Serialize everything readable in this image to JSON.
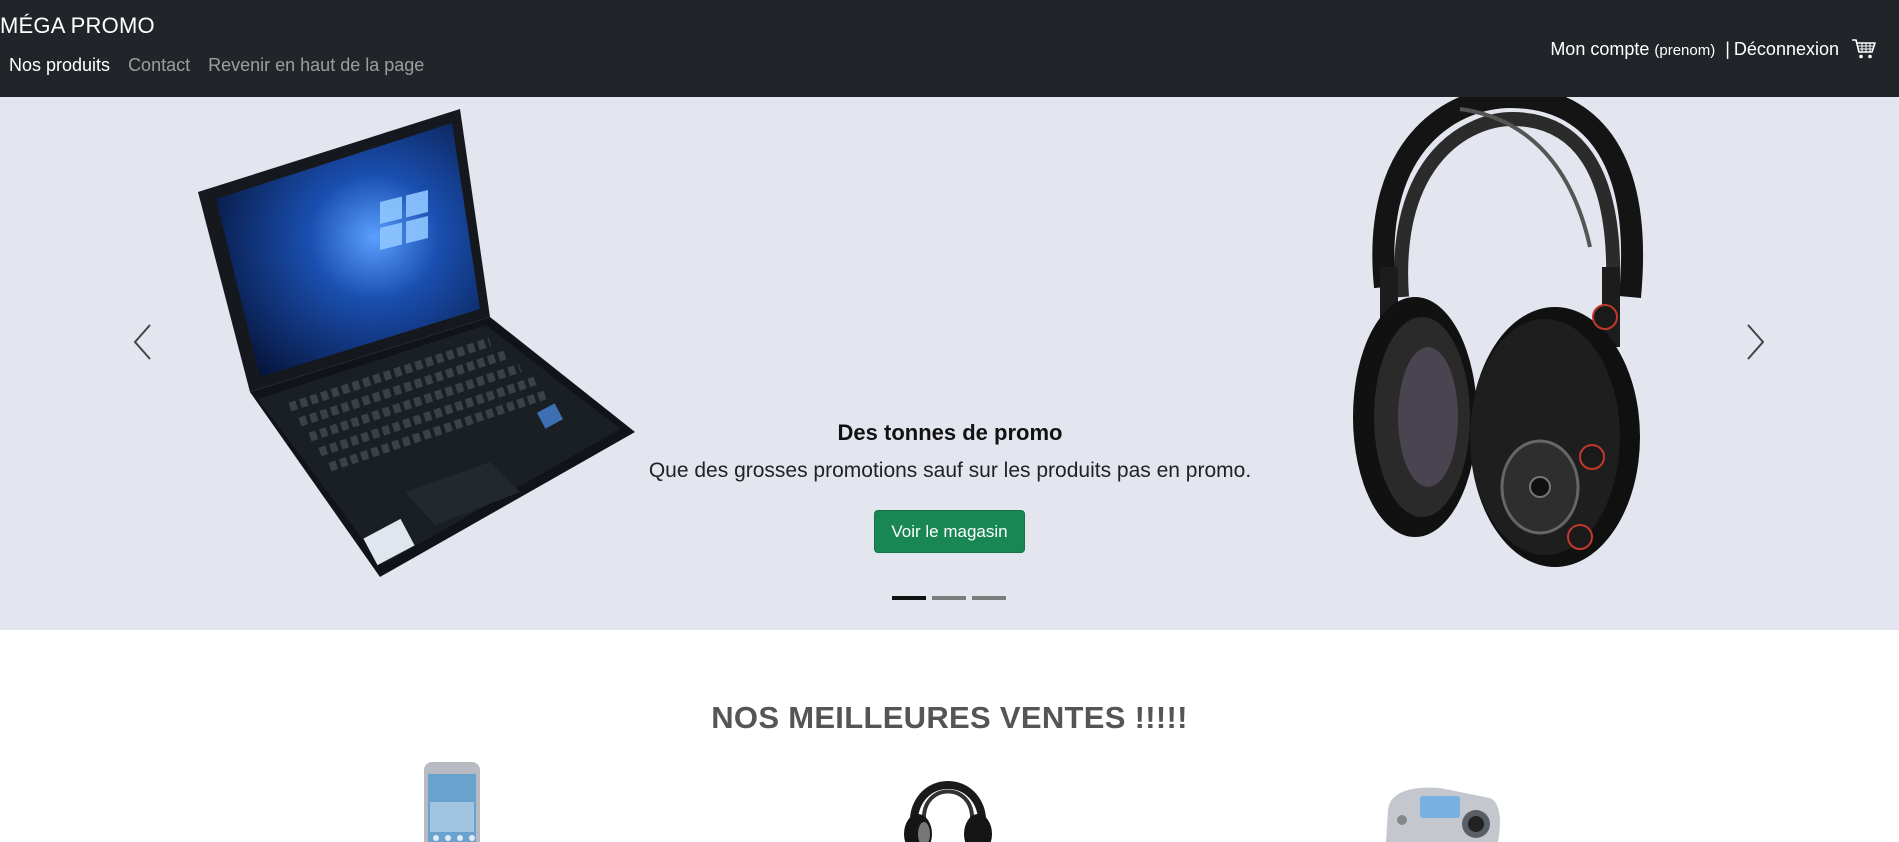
{
  "navbar": {
    "brand": "MÉGA PROMO",
    "links": [
      {
        "label": "Nos produits",
        "active": true
      },
      {
        "label": "Contact",
        "active": false
      },
      {
        "label": "Revenir en haut de la page",
        "active": false
      }
    ],
    "account_label": "Mon compte",
    "account_user": "(prenom)",
    "separator": "|",
    "logout_label": "Déconnexion",
    "cart_icon": "cart-icon"
  },
  "carousel": {
    "caption_title": "Des tonnes de promo",
    "caption_text": "Que des grosses promotions sauf sur les produits pas en promo.",
    "button_label": "Voir le magasin",
    "slide_count": 3,
    "active_slide": 1,
    "prev_icon": "chevron-left-icon",
    "next_icon": "chevron-right-icon"
  },
  "best_sellers": {
    "title": "NOS MEILLEURES VENTES !!!!!"
  },
  "colors": {
    "navbar_bg": "#212529",
    "carousel_bg": "#e3e6ee",
    "button_bg": "#198754",
    "section_title": "#555555"
  }
}
